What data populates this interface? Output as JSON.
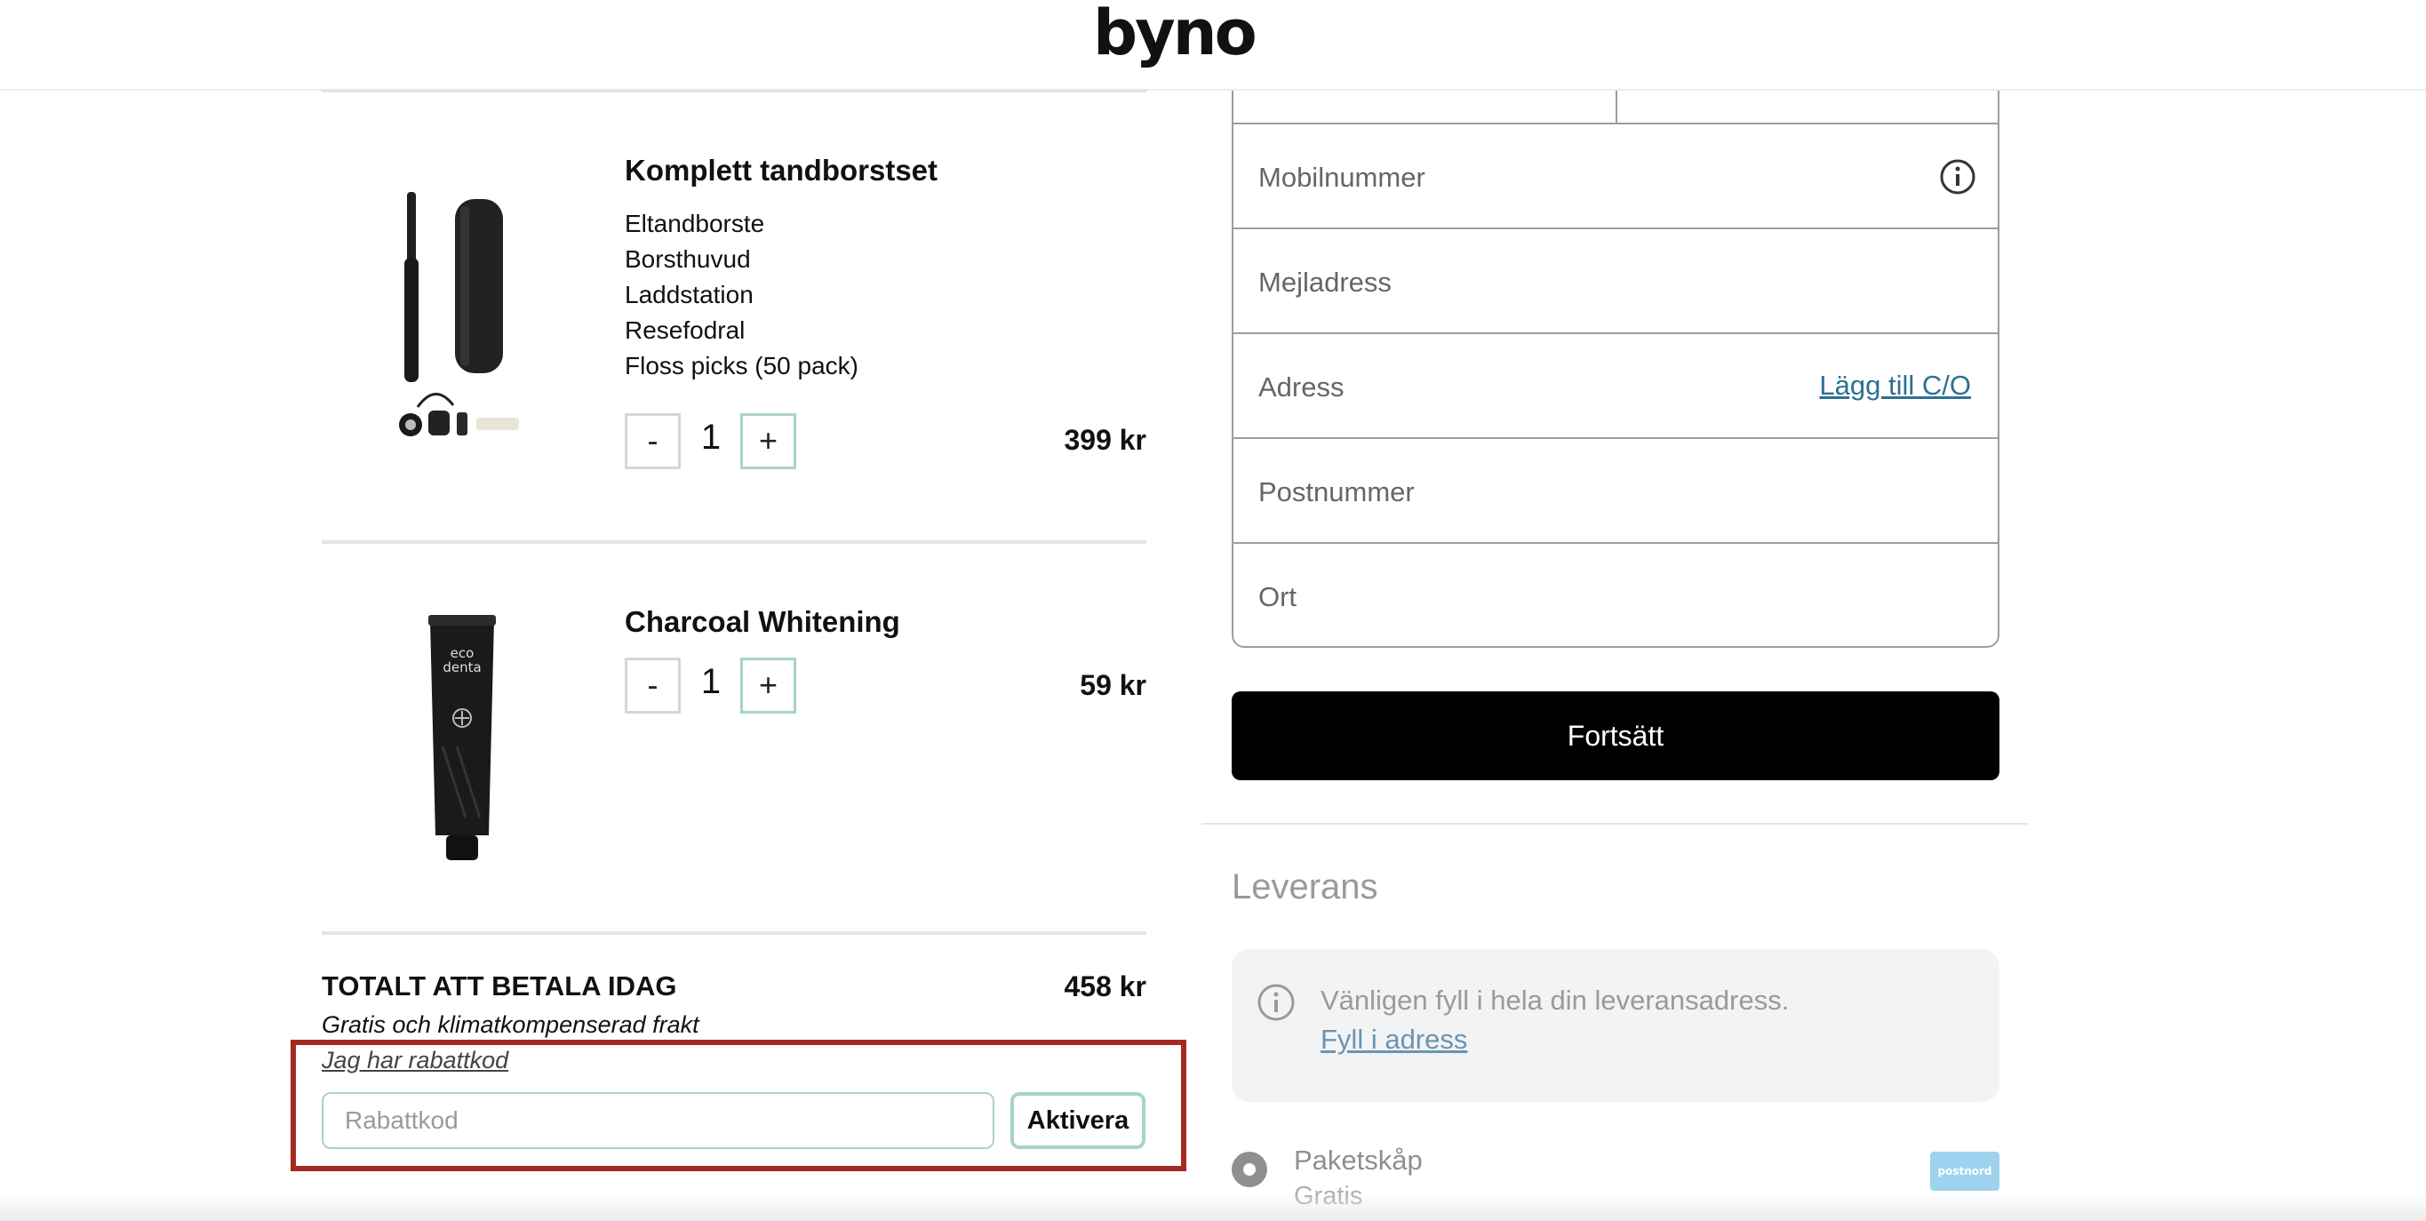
{
  "brand": {
    "logo": "byno"
  },
  "cart": {
    "items": [
      {
        "title": "Komplett tandborstset",
        "contents": [
          "Eltandborste",
          "Borsthuvud",
          "Laddstation",
          "Resefodral",
          "Floss picks (50 pack)"
        ],
        "quantity": "1",
        "price": "399 kr",
        "minus_label": "-",
        "plus_label": "+"
      },
      {
        "title": "Charcoal Whitening",
        "quantity": "1",
        "price": "59 kr",
        "minus_label": "-",
        "plus_label": "+",
        "tube_text": "eco denta"
      }
    ],
    "total_label": "TOTALT ATT BETALA IDAG",
    "total_price": "458 kr",
    "shipping_note": "Gratis och klimatkompenserad frakt",
    "promo_link": "Jag har rabattkod",
    "promo_placeholder": "Rabattkod",
    "activate_label": "Aktivera"
  },
  "form": {
    "fields": {
      "phone": "Mobilnummer",
      "email": "Mejladress",
      "address": "Adress",
      "postcode": "Postnummer",
      "city": "Ort"
    },
    "co_link": "Lägg till C/O",
    "continue_label": "Fortsätt"
  },
  "delivery": {
    "title": "Leverans",
    "notice_text": "Vänligen fyll i hela din leveransadress.",
    "notice_link": "Fyll i adress",
    "option_name": "Paketskåp",
    "option_price": "Gratis",
    "carrier": "postnord"
  },
  "colors": {
    "accent_border": "#a9d3c8",
    "highlight": "#a42a20",
    "button_dark": "#000000",
    "link": "#2e6f92"
  }
}
